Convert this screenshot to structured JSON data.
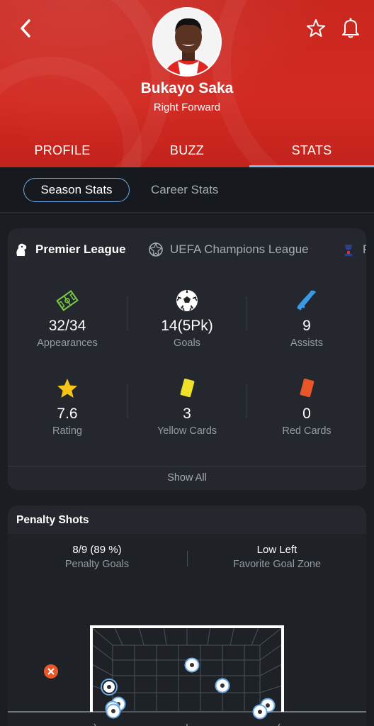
{
  "header": {
    "player_name": "Bukayo Saka",
    "position": "Right Forward",
    "back_icon": "chevron-left-icon",
    "favorite_icon": "star-outline-icon",
    "notify_icon": "bell-icon"
  },
  "tabs": [
    {
      "label": "PROFILE",
      "active": false
    },
    {
      "label": "BUZZ",
      "active": false
    },
    {
      "label": "STATS",
      "active": true
    }
  ],
  "stats_mode": {
    "selected": "Season Stats",
    "other": "Career Stats"
  },
  "leagues": [
    {
      "label": "Premier League",
      "active": true
    },
    {
      "label": "UEFA Champions League",
      "active": false
    },
    {
      "label": "F",
      "active": false
    }
  ],
  "stats": [
    {
      "value": "32/34",
      "label": "Appearances",
      "icon": "pitch-icon"
    },
    {
      "value": "14(5Pk)",
      "label": "Goals",
      "icon": "football-icon"
    },
    {
      "value": "9",
      "label": "Assists",
      "icon": "boot-icon"
    },
    {
      "value": "7.6",
      "label": "Rating",
      "icon": "star-icon"
    },
    {
      "value": "3",
      "label": "Yellow Cards",
      "icon": "yellow-card-icon"
    },
    {
      "value": "0",
      "label": "Red Cards",
      "icon": "red-card-icon"
    }
  ],
  "show_all": "Show All",
  "penalty": {
    "title": "Penalty Shots",
    "goals_value": "8/9 (89 %)",
    "goals_label": "Penalty Goals",
    "zone_value": "Low Left",
    "zone_label": "Favorite Goal Zone"
  },
  "colors": {
    "header_red": "#d22a22",
    "accent_blue": "#6aa9e6",
    "background": "#1a1d22",
    "card": "#24272d"
  }
}
